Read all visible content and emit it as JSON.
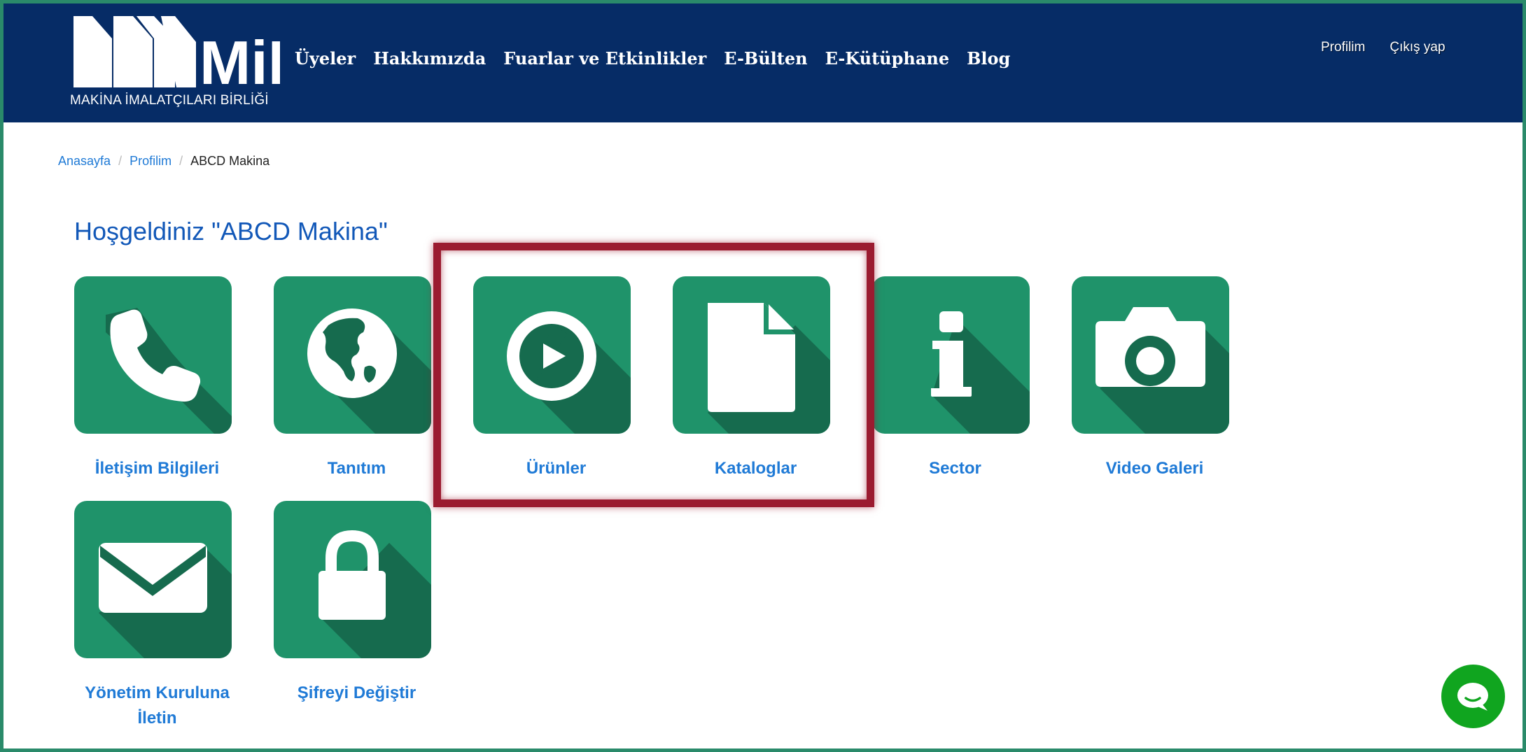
{
  "brand": {
    "logo_text": "MiB",
    "logo_subtitle": "MAKİNA İMALATÇILARI BİRLİĞİ",
    "header_color": "#062c66"
  },
  "nav": {
    "items": [
      "Üyeler",
      "Hakkımızda",
      "Fuarlar ve Etkinlikler",
      "E-Bülten",
      "E-Kütüphane",
      "Blog"
    ]
  },
  "top_links": {
    "profile": "Profilim",
    "logout": "Çıkış yap"
  },
  "breadcrumb": {
    "home": "Anasayfa",
    "profile": "Profilim",
    "current": "ABCD Makina"
  },
  "page": {
    "welcome": "Hoşgeldiniz \"ABCD Makina\""
  },
  "tiles": [
    {
      "label": "İletişim Bilgileri",
      "icon": "phone-icon"
    },
    {
      "label": "Tanıtım",
      "icon": "globe-icon"
    },
    {
      "label": "Ürünler",
      "icon": "play-circle-icon"
    },
    {
      "label": "Kataloglar",
      "icon": "document-icon"
    },
    {
      "label": "Sector",
      "icon": "info-icon"
    },
    {
      "label": "Video Galeri",
      "icon": "camera-icon"
    },
    {
      "label": "Yönetim Kuruluna İletin",
      "icon": "envelope-icon"
    },
    {
      "label": "Şifreyi Değiştir",
      "icon": "lock-icon"
    }
  ],
  "colors": {
    "tile_bg": "#1f936a",
    "tile_shadow": "#166b4e",
    "link": "#1f7ad6",
    "highlight": "#9b1b30",
    "chat": "#10a51f"
  },
  "chat": {
    "icon": "chat-bubble-icon"
  }
}
